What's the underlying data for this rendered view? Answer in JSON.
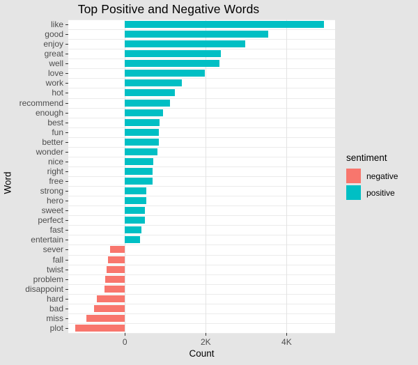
{
  "chart_data": {
    "type": "bar",
    "title": "Top Positive and Negative Words",
    "xlabel": "Count",
    "ylabel": "Word",
    "orientation": "horizontal",
    "grid": true,
    "legend_position": "right",
    "legend_title": "sentiment",
    "xlim": [
      -1400,
      5200
    ],
    "xticks": [
      0,
      2000,
      4000
    ],
    "xtick_labels": [
      "0",
      "2K",
      "4K"
    ],
    "colors": {
      "negative": "#F8766D",
      "positive": "#00BFC4",
      "panel_background": "#FFFFFF",
      "plot_background": "#E5E5E5",
      "gridline": "#EBEBEB"
    },
    "legend_entries": [
      {
        "label": "negative",
        "color": "#F8766D"
      },
      {
        "label": "positive",
        "color": "#00BFC4"
      }
    ],
    "categories": [
      "like",
      "good",
      "enjoy",
      "great",
      "well",
      "love",
      "work",
      "hot",
      "recommend",
      "enough",
      "best",
      "fun",
      "better",
      "wonder",
      "nice",
      "right",
      "free",
      "strong",
      "hero",
      "sweet",
      "perfect",
      "fast",
      "entertain",
      "sever",
      "fall",
      "twist",
      "problem",
      "disappoint",
      "hard",
      "bad",
      "miss",
      "plot"
    ],
    "values": [
      4920,
      3550,
      2980,
      2370,
      2340,
      1970,
      1410,
      1230,
      1120,
      940,
      860,
      840,
      840,
      810,
      700,
      690,
      690,
      530,
      530,
      490,
      495,
      410,
      375,
      -370,
      -420,
      -455,
      -495,
      -510,
      -685,
      -755,
      -950,
      -1235
    ],
    "groups": [
      "positive",
      "positive",
      "positive",
      "positive",
      "positive",
      "positive",
      "positive",
      "positive",
      "positive",
      "positive",
      "positive",
      "positive",
      "positive",
      "positive",
      "positive",
      "positive",
      "positive",
      "positive",
      "positive",
      "positive",
      "positive",
      "positive",
      "positive",
      "negative",
      "negative",
      "negative",
      "negative",
      "negative",
      "negative",
      "negative",
      "negative",
      "negative"
    ]
  }
}
